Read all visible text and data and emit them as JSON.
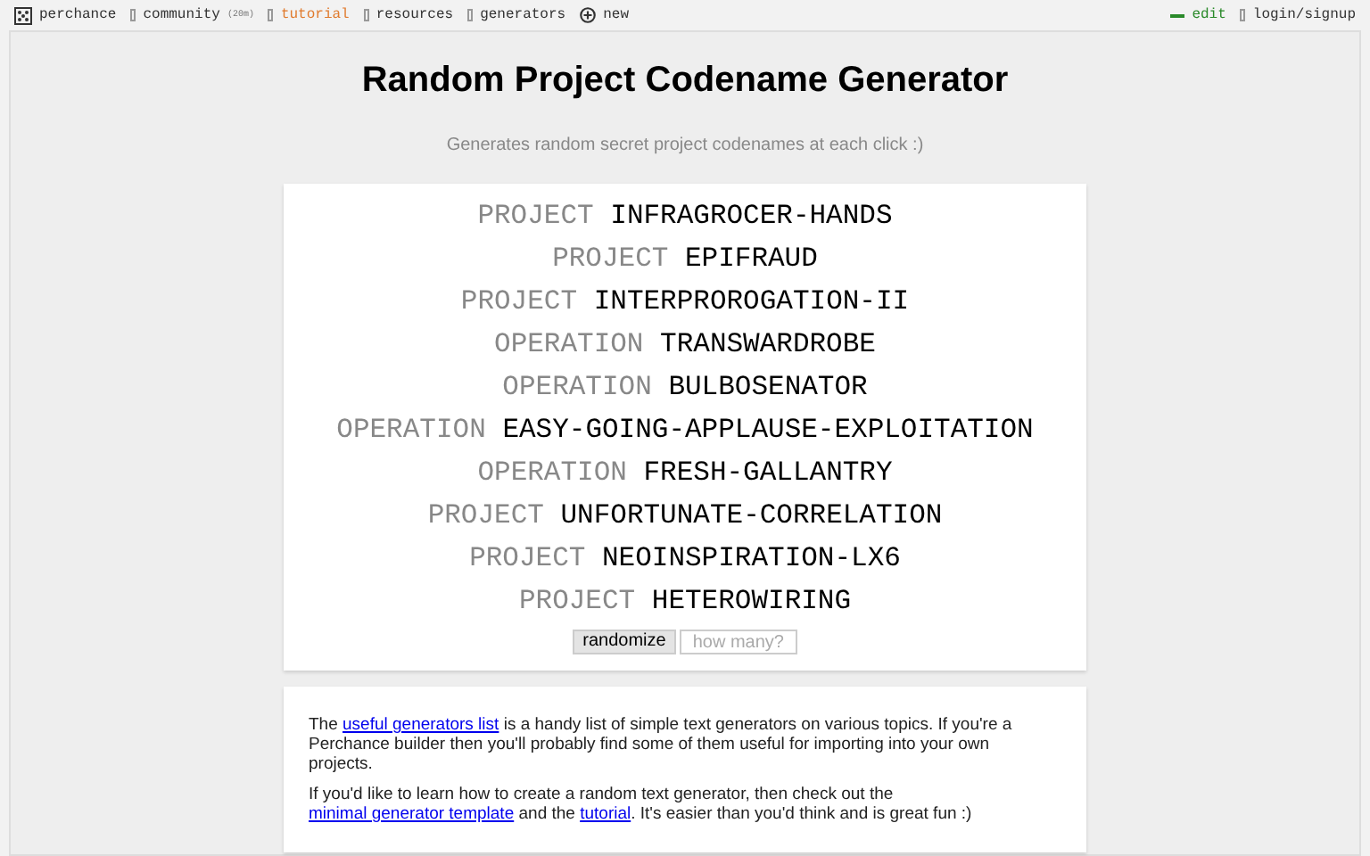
{
  "nav": [
    {
      "label": "perchance",
      "kind": "logo",
      "selected": false
    },
    {
      "label": "community",
      "badge": "(20m)",
      "kind": "item",
      "selected": false
    },
    {
      "label": "tutorial",
      "kind": "item",
      "selected": true
    },
    {
      "label": "resources",
      "kind": "item",
      "selected": false
    },
    {
      "label": "generators",
      "kind": "item",
      "selected": false
    },
    {
      "label": "new",
      "kind": "new",
      "selected": false
    }
  ],
  "nav_right": [
    {
      "label": "edit",
      "kind": "edit"
    },
    {
      "label": "login/signup",
      "kind": "item"
    }
  ],
  "title": "Random Project Codename Generator",
  "subtitle": "Generates random secret project codenames at each click :)",
  "codenames": [
    {
      "prefix": "PROJECT",
      "name": "INFRAGROCER-HANDS"
    },
    {
      "prefix": "PROJECT",
      "name": "EPIFRAUD"
    },
    {
      "prefix": "PROJECT",
      "name": "INTERPROROGATION-II"
    },
    {
      "prefix": "OPERATION",
      "name": "TRANSWARDROBE"
    },
    {
      "prefix": "OPERATION",
      "name": "BULBOSENATOR"
    },
    {
      "prefix": "OPERATION",
      "name": "EASY-GOING-APPLAUSE-EXPLOITATION"
    },
    {
      "prefix": "OPERATION",
      "name": "FRESH-GALLANTRY"
    },
    {
      "prefix": "PROJECT",
      "name": "UNFORTUNATE-CORRELATION"
    },
    {
      "prefix": "PROJECT",
      "name": "NEOINSPIRATION-LX6"
    },
    {
      "prefix": "PROJECT",
      "name": "HETEROWIRING"
    }
  ],
  "randomize_button": "randomize",
  "count_field": {
    "placeholder": "how many?"
  },
  "info": [
    [
      {
        "kind": "text",
        "text": "The "
      },
      {
        "kind": "link",
        "text": "useful generators list"
      },
      {
        "kind": "text",
        "text": " is a handy list of simple text generators on various topics. If you're a Perchance builder then you'll probably find some of them useful for importing into your own projects."
      }
    ],
    [
      {
        "kind": "text",
        "text": "If you'd like to learn how to create a random text generator, then check out the "
      },
      {
        "kind": "link",
        "text": "minimal generator template"
      },
      {
        "kind": "text",
        "text": " and the "
      },
      {
        "kind": "link",
        "text": "tutorial"
      },
      {
        "kind": "text",
        "text": ". It's easier than you'd think and is great fun :)"
      }
    ]
  ]
}
